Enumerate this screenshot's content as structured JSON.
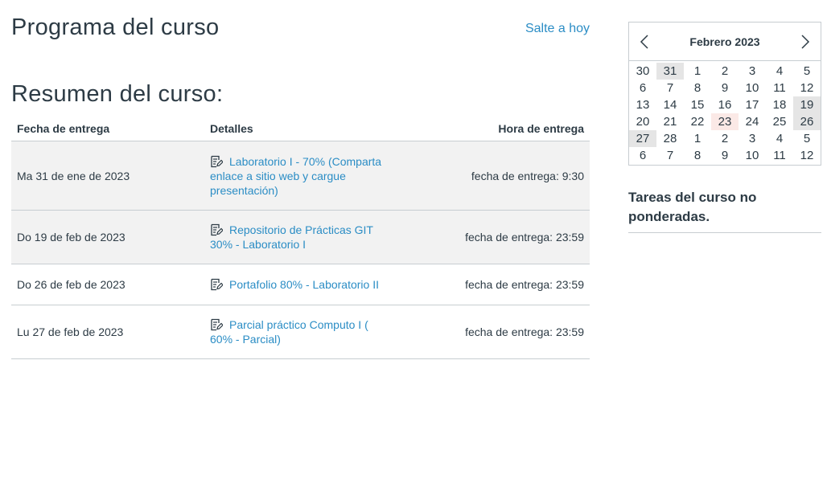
{
  "page": {
    "title": "Programa del curso",
    "jump_link": "Salte a hoy",
    "summary_title": "Resumen del curso:"
  },
  "table": {
    "headers": {
      "date": "Fecha de entrega",
      "details": "Detalles",
      "due": "Hora de entrega"
    },
    "rows": [
      {
        "date": "Ma 31 de ene de 2023",
        "assignment": "Laboratorio I - 70% (Comparta enlace a sitio web y cargue presentación)",
        "due": "fecha de entrega: 9:30"
      },
      {
        "date": "Do 19 de feb de 2023",
        "assignment": "Repositorio de Prácticas GIT 30% - Laboratorio I",
        "due": "fecha de entrega: 23:59"
      },
      {
        "date": "Do 26 de feb de 2023",
        "assignment": "Portafolio 80% - Laboratorio II",
        "due": "fecha de entrega: 23:59"
      },
      {
        "date": "Lu 27 de feb de 2023",
        "assignment": "Parcial práctico Computo I ( 60% - Parcial)",
        "due": "fecha de entrega: 23:59"
      }
    ]
  },
  "calendar": {
    "month_label": "Febrero 2023",
    "prev_icon": "chevron-left-icon",
    "next_icon": "chevron-right-icon",
    "weeks": [
      [
        "30",
        "31",
        "1",
        "2",
        "3",
        "4",
        "5"
      ],
      [
        "6",
        "7",
        "8",
        "9",
        "10",
        "11",
        "12"
      ],
      [
        "13",
        "14",
        "15",
        "16",
        "17",
        "18",
        "19"
      ],
      [
        "20",
        "21",
        "22",
        "23",
        "24",
        "25",
        "26"
      ],
      [
        "27",
        "28",
        "1",
        "2",
        "3",
        "4",
        "5"
      ],
      [
        "6",
        "7",
        "8",
        "9",
        "10",
        "11",
        "12"
      ]
    ],
    "highlighted_days": [
      "31",
      "19",
      "26",
      "27"
    ],
    "today": "23"
  },
  "sidebar": {
    "heading": "Tareas del curso no ponderadas."
  },
  "colors": {
    "link": "#2b8dc5",
    "text": "#2d3b45",
    "row_shade": "#f2f2f2",
    "day_highlight": "#e5e5e5",
    "today_highlight": "#fbe9e6"
  }
}
